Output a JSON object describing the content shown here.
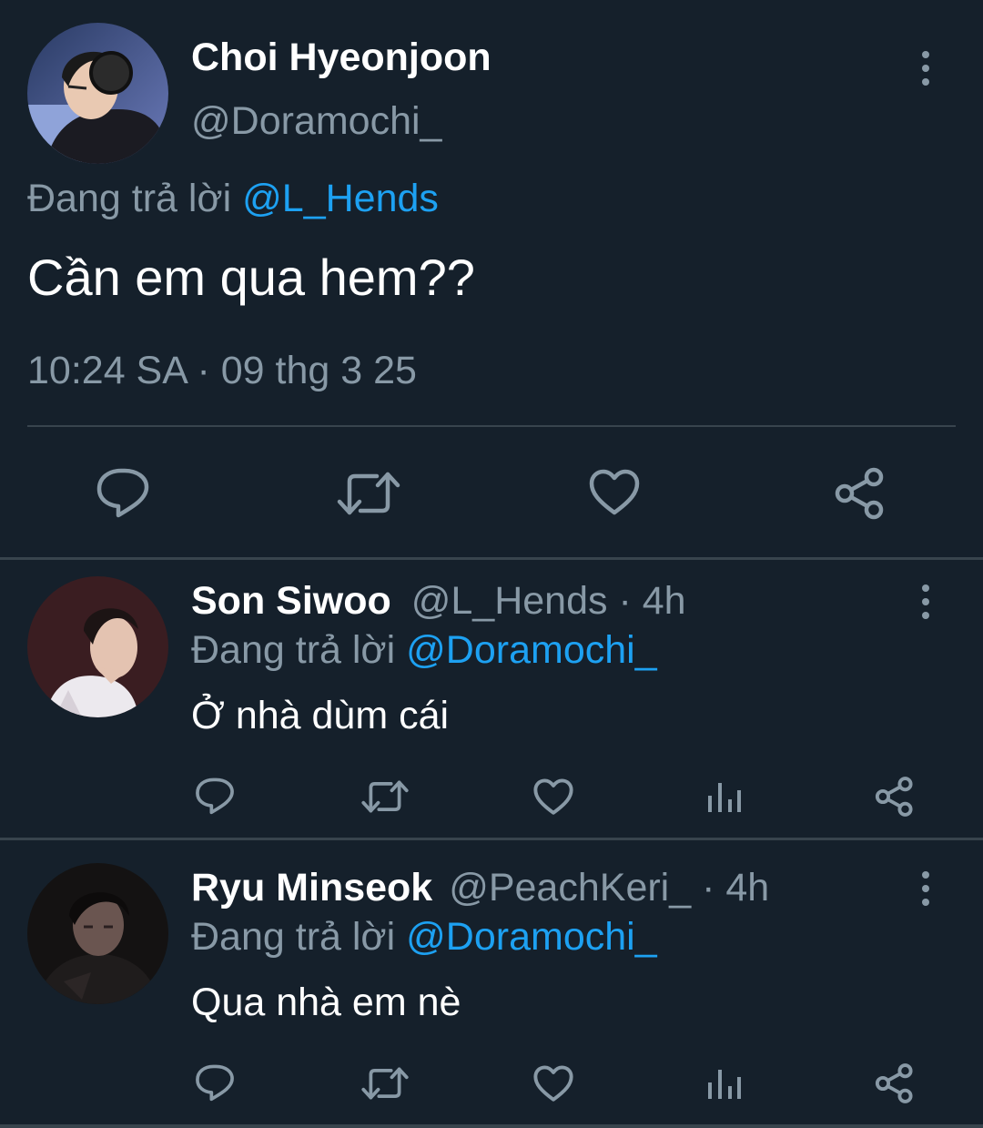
{
  "main_tweet": {
    "display_name": "Choi Hyeonjoon",
    "handle": "@Doramochi_",
    "replying_prefix": "Đang trả lời",
    "replying_to": "@L_Hends",
    "text": "Cần em qua hem??",
    "timestamp": "10:24 SA · 09 thg 3 25",
    "actions": [
      "reply-icon",
      "retweet-icon",
      "like-icon",
      "share-icon"
    ]
  },
  "replies": [
    {
      "display_name": "Son Siwoo",
      "handle": "@L_Hends",
      "age": "· 4h",
      "replying_prefix": "Đang trả lời",
      "replying_to": "@Doramochi_",
      "text": "Ở nhà dùm cái",
      "actions": [
        "reply-icon",
        "retweet-icon",
        "like-icon",
        "analytics-icon",
        "share-icon"
      ]
    },
    {
      "display_name": "Ryu Minseok",
      "handle": "@PeachKeri_",
      "age": "· 4h",
      "replying_prefix": "Đang trả lời",
      "replying_to": "@Doramochi_",
      "text": "Qua nhà em nè",
      "actions": [
        "reply-icon",
        "retweet-icon",
        "like-icon",
        "analytics-icon",
        "share-icon"
      ]
    }
  ],
  "colors": {
    "background": "#15202b",
    "text": "#ffffff",
    "muted": "#8899a6",
    "link": "#1da1f2",
    "divider": "#38444d"
  }
}
